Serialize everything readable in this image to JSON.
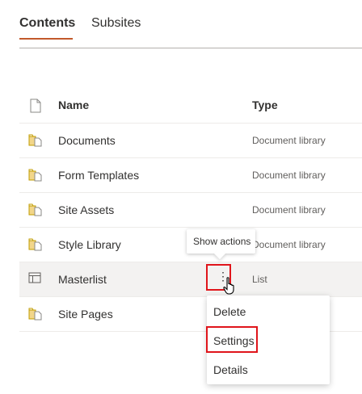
{
  "tabs": [
    {
      "label": "Contents",
      "active": true
    },
    {
      "label": "Subsites",
      "active": false
    }
  ],
  "table": {
    "columns": {
      "name": "Name",
      "type": "Type"
    },
    "rows": [
      {
        "name": "Documents",
        "type": "Document library",
        "icon": "document-library-icon"
      },
      {
        "name": "Form Templates",
        "type": "Document library",
        "icon": "document-library-icon"
      },
      {
        "name": "Site Assets",
        "type": "Document library",
        "icon": "document-library-icon"
      },
      {
        "name": "Style Library",
        "type": "Document library",
        "icon": "document-library-icon"
      },
      {
        "name": "Masterlist",
        "type": "List",
        "icon": "list-icon",
        "selected": true
      },
      {
        "name": "Site Pages",
        "type": "",
        "icon": "document-library-icon"
      }
    ]
  },
  "tooltip": {
    "text": "Show actions"
  },
  "context_menu": {
    "items": [
      "Delete",
      "Settings",
      "Details"
    ],
    "highlighted": "Settings"
  },
  "colors": {
    "accent": "#c2592b",
    "highlight_box": "#e0151b",
    "library_icon": "#c19c00",
    "selected_row": "#f3f2f1"
  }
}
